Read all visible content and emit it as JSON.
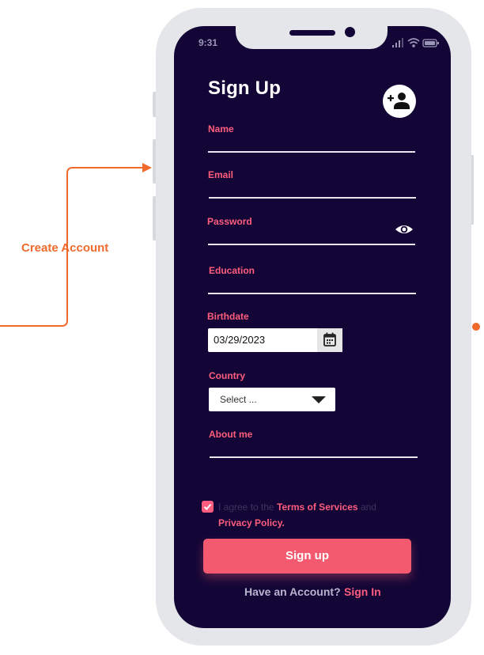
{
  "annotation": {
    "label": "Create Account",
    "accent_color": "#f06a2c"
  },
  "status_bar": {
    "time": "9:31"
  },
  "form": {
    "title": "Sign Up",
    "fields": {
      "name": {
        "label": "Name",
        "value": ""
      },
      "email": {
        "label": "Email",
        "value": ""
      },
      "password": {
        "label": "Password",
        "value": "",
        "icon": "eye-icon"
      },
      "education": {
        "label": "Education",
        "value": ""
      },
      "birthdate": {
        "label": "Birthdate",
        "value": "03/29/2023",
        "icon": "calendar-icon"
      },
      "country": {
        "label": "Country",
        "value": "Select ..."
      },
      "about": {
        "label": "About me",
        "value": ""
      }
    },
    "agreement": {
      "checked": true,
      "prefix": "I agree to the ",
      "terms": "Terms of Services",
      "middle": " and ",
      "privacy": "Privacy Policy."
    },
    "submit_label": "Sign up",
    "footer": {
      "prompt": "Have an Account?",
      "link": "Sign In"
    }
  },
  "colors": {
    "screen_bg": "#130637",
    "accent": "#ff5d7d",
    "button": "#f35a6f",
    "frame": "#e4e6ea"
  }
}
